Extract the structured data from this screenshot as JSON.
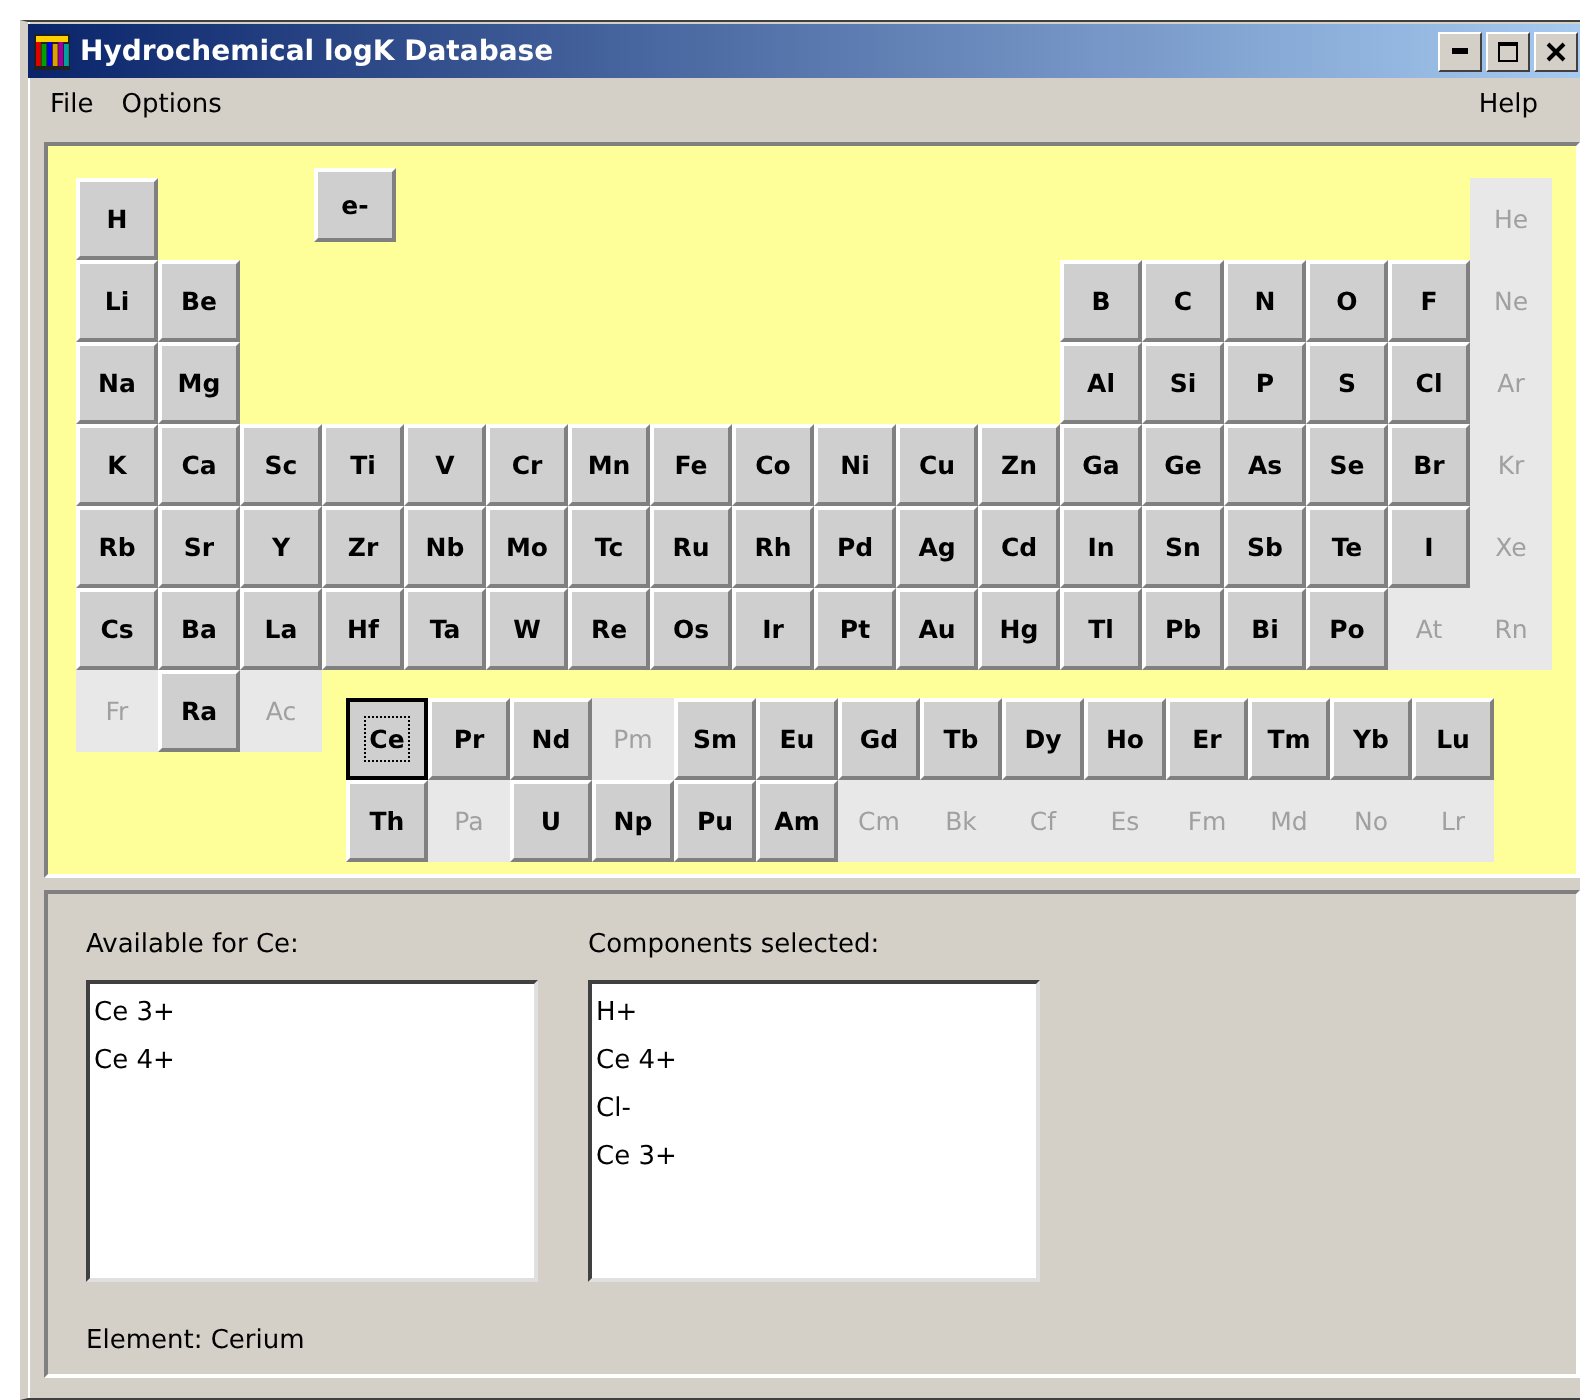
{
  "window": {
    "title": "Hydrochemical logK Database"
  },
  "menu": {
    "left": [
      "File",
      "Options"
    ],
    "right": [
      "Help"
    ]
  },
  "electron": {
    "label": "e-",
    "enabled": true
  },
  "main_rows": [
    {
      "left": [
        {
          "symbol": "H",
          "enabled": true,
          "selected": false
        }
      ],
      "right": [
        {
          "symbol": "He",
          "enabled": false,
          "selected": false
        }
      ]
    },
    {
      "left": [
        {
          "symbol": "Li",
          "enabled": true,
          "selected": false
        },
        {
          "symbol": "Be",
          "enabled": true,
          "selected": false
        }
      ],
      "right": [
        {
          "symbol": "B",
          "enabled": true,
          "selected": false
        },
        {
          "symbol": "C",
          "enabled": true,
          "selected": false
        },
        {
          "symbol": "N",
          "enabled": true,
          "selected": false
        },
        {
          "symbol": "O",
          "enabled": true,
          "selected": false
        },
        {
          "symbol": "F",
          "enabled": true,
          "selected": false
        },
        {
          "symbol": "Ne",
          "enabled": false,
          "selected": false
        }
      ]
    },
    {
      "left": [
        {
          "symbol": "Na",
          "enabled": true,
          "selected": false
        },
        {
          "symbol": "Mg",
          "enabled": true,
          "selected": false
        }
      ],
      "right": [
        {
          "symbol": "Al",
          "enabled": true,
          "selected": false
        },
        {
          "symbol": "Si",
          "enabled": true,
          "selected": false
        },
        {
          "symbol": "P",
          "enabled": true,
          "selected": false
        },
        {
          "symbol": "S",
          "enabled": true,
          "selected": false
        },
        {
          "symbol": "Cl",
          "enabled": true,
          "selected": false
        },
        {
          "symbol": "Ar",
          "enabled": false,
          "selected": false
        }
      ]
    },
    {
      "left": [
        {
          "symbol": "K",
          "enabled": true,
          "selected": false
        },
        {
          "symbol": "Ca",
          "enabled": true,
          "selected": false
        },
        {
          "symbol": "Sc",
          "enabled": true,
          "selected": false
        },
        {
          "symbol": "Ti",
          "enabled": true,
          "selected": false
        },
        {
          "symbol": "V",
          "enabled": true,
          "selected": false
        },
        {
          "symbol": "Cr",
          "enabled": true,
          "selected": false
        },
        {
          "symbol": "Mn",
          "enabled": true,
          "selected": false
        },
        {
          "symbol": "Fe",
          "enabled": true,
          "selected": false
        },
        {
          "symbol": "Co",
          "enabled": true,
          "selected": false
        },
        {
          "symbol": "Ni",
          "enabled": true,
          "selected": false
        },
        {
          "symbol": "Cu",
          "enabled": true,
          "selected": false
        },
        {
          "symbol": "Zn",
          "enabled": true,
          "selected": false
        },
        {
          "symbol": "Ga",
          "enabled": true,
          "selected": false
        },
        {
          "symbol": "Ge",
          "enabled": true,
          "selected": false
        },
        {
          "symbol": "As",
          "enabled": true,
          "selected": false
        },
        {
          "symbol": "Se",
          "enabled": true,
          "selected": false
        },
        {
          "symbol": "Br",
          "enabled": true,
          "selected": false
        },
        {
          "symbol": "Kr",
          "enabled": false,
          "selected": false
        }
      ],
      "right": []
    },
    {
      "left": [
        {
          "symbol": "Rb",
          "enabled": true,
          "selected": false
        },
        {
          "symbol": "Sr",
          "enabled": true,
          "selected": false
        },
        {
          "symbol": "Y",
          "enabled": true,
          "selected": false
        },
        {
          "symbol": "Zr",
          "enabled": true,
          "selected": false
        },
        {
          "symbol": "Nb",
          "enabled": true,
          "selected": false
        },
        {
          "symbol": "Mo",
          "enabled": true,
          "selected": false
        },
        {
          "symbol": "Tc",
          "enabled": true,
          "selected": false
        },
        {
          "symbol": "Ru",
          "enabled": true,
          "selected": false
        },
        {
          "symbol": "Rh",
          "enabled": true,
          "selected": false
        },
        {
          "symbol": "Pd",
          "enabled": true,
          "selected": false
        },
        {
          "symbol": "Ag",
          "enabled": true,
          "selected": false
        },
        {
          "symbol": "Cd",
          "enabled": true,
          "selected": false
        },
        {
          "symbol": "In",
          "enabled": true,
          "selected": false
        },
        {
          "symbol": "Sn",
          "enabled": true,
          "selected": false
        },
        {
          "symbol": "Sb",
          "enabled": true,
          "selected": false
        },
        {
          "symbol": "Te",
          "enabled": true,
          "selected": false
        },
        {
          "symbol": "I",
          "enabled": true,
          "selected": false
        },
        {
          "symbol": "Xe",
          "enabled": false,
          "selected": false
        }
      ],
      "right": []
    },
    {
      "left": [
        {
          "symbol": "Cs",
          "enabled": true,
          "selected": false
        },
        {
          "symbol": "Ba",
          "enabled": true,
          "selected": false
        },
        {
          "symbol": "La",
          "enabled": true,
          "selected": false
        },
        {
          "symbol": "Hf",
          "enabled": true,
          "selected": false
        },
        {
          "symbol": "Ta",
          "enabled": true,
          "selected": false
        },
        {
          "symbol": "W",
          "enabled": true,
          "selected": false
        },
        {
          "symbol": "Re",
          "enabled": true,
          "selected": false
        },
        {
          "symbol": "Os",
          "enabled": true,
          "selected": false
        },
        {
          "symbol": "Ir",
          "enabled": true,
          "selected": false
        },
        {
          "symbol": "Pt",
          "enabled": true,
          "selected": false
        },
        {
          "symbol": "Au",
          "enabled": true,
          "selected": false
        },
        {
          "symbol": "Hg",
          "enabled": true,
          "selected": false
        },
        {
          "symbol": "Tl",
          "enabled": true,
          "selected": false
        },
        {
          "symbol": "Pb",
          "enabled": true,
          "selected": false
        },
        {
          "symbol": "Bi",
          "enabled": true,
          "selected": false
        },
        {
          "symbol": "Po",
          "enabled": true,
          "selected": false
        },
        {
          "symbol": "At",
          "enabled": false,
          "selected": false
        },
        {
          "symbol": "Rn",
          "enabled": false,
          "selected": false
        }
      ],
      "right": []
    },
    {
      "left": [
        {
          "symbol": "Fr",
          "enabled": false,
          "selected": false
        },
        {
          "symbol": "Ra",
          "enabled": true,
          "selected": false
        },
        {
          "symbol": "Ac",
          "enabled": false,
          "selected": false
        }
      ],
      "right": []
    }
  ],
  "f_rows": [
    [
      {
        "symbol": "Ce",
        "enabled": true,
        "selected": true
      },
      {
        "symbol": "Pr",
        "enabled": true,
        "selected": false
      },
      {
        "symbol": "Nd",
        "enabled": true,
        "selected": false
      },
      {
        "symbol": "Pm",
        "enabled": false,
        "selected": false
      },
      {
        "symbol": "Sm",
        "enabled": true,
        "selected": false
      },
      {
        "symbol": "Eu",
        "enabled": true,
        "selected": false
      },
      {
        "symbol": "Gd",
        "enabled": true,
        "selected": false
      },
      {
        "symbol": "Tb",
        "enabled": true,
        "selected": false
      },
      {
        "symbol": "Dy",
        "enabled": true,
        "selected": false
      },
      {
        "symbol": "Ho",
        "enabled": true,
        "selected": false
      },
      {
        "symbol": "Er",
        "enabled": true,
        "selected": false
      },
      {
        "symbol": "Tm",
        "enabled": true,
        "selected": false
      },
      {
        "symbol": "Yb",
        "enabled": true,
        "selected": false
      },
      {
        "symbol": "Lu",
        "enabled": true,
        "selected": false
      }
    ],
    [
      {
        "symbol": "Th",
        "enabled": true,
        "selected": false
      },
      {
        "symbol": "Pa",
        "enabled": false,
        "selected": false
      },
      {
        "symbol": "U",
        "enabled": true,
        "selected": false
      },
      {
        "symbol": "Np",
        "enabled": true,
        "selected": false
      },
      {
        "symbol": "Pu",
        "enabled": true,
        "selected": false
      },
      {
        "symbol": "Am",
        "enabled": true,
        "selected": false
      },
      {
        "symbol": "Cm",
        "enabled": false,
        "selected": false
      },
      {
        "symbol": "Bk",
        "enabled": false,
        "selected": false
      },
      {
        "symbol": "Cf",
        "enabled": false,
        "selected": false
      },
      {
        "symbol": "Es",
        "enabled": false,
        "selected": false
      },
      {
        "symbol": "Fm",
        "enabled": false,
        "selected": false
      },
      {
        "symbol": "Md",
        "enabled": false,
        "selected": false
      },
      {
        "symbol": "No",
        "enabled": false,
        "selected": false
      },
      {
        "symbol": "Lr",
        "enabled": false,
        "selected": false
      }
    ]
  ],
  "available": {
    "label": "Available for Ce:",
    "items": [
      "Ce 3+",
      "Ce 4+"
    ]
  },
  "components": {
    "label": "Components selected:",
    "items": [
      "H+",
      "Ce 4+",
      "Cl-",
      "Ce 3+"
    ]
  },
  "status": "Element: Cerium"
}
